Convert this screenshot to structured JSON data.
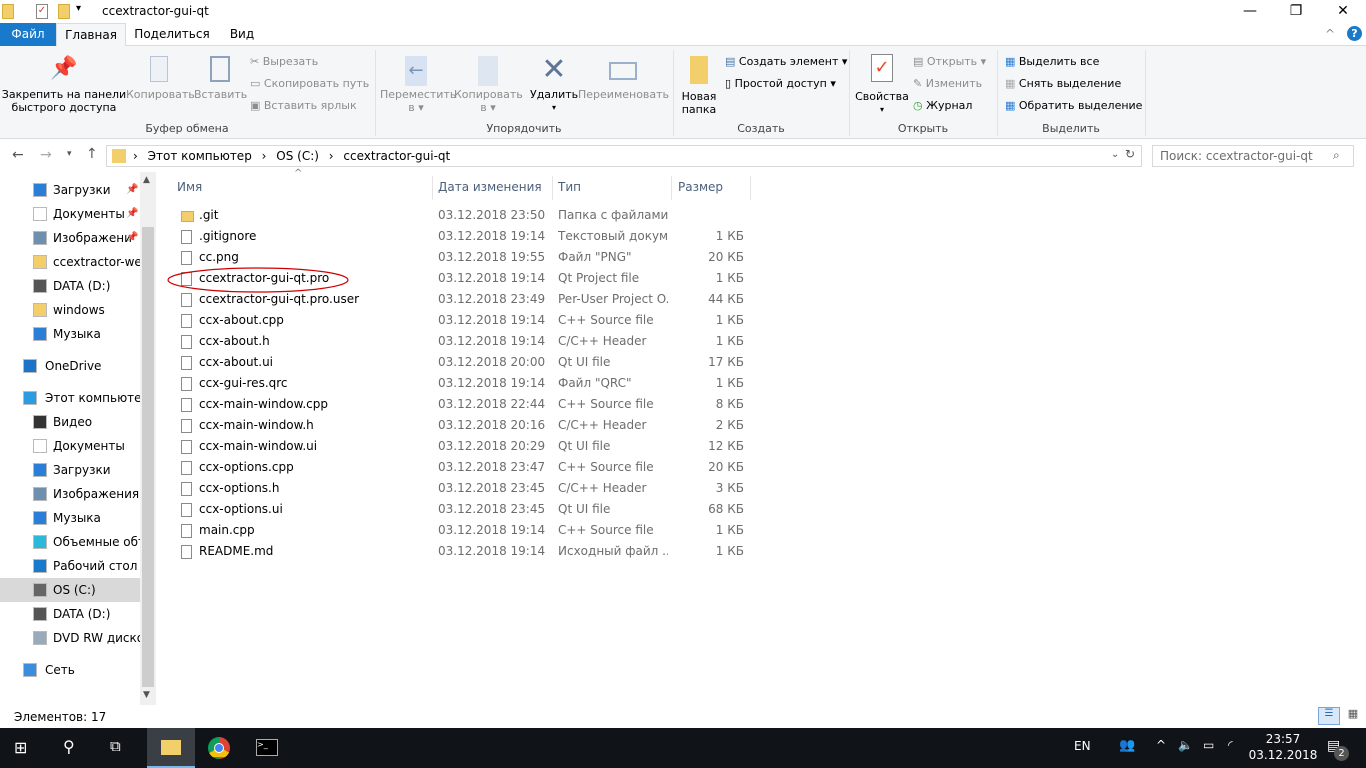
{
  "window": {
    "title": "ccextractor-gui-qt",
    "minimize": "—",
    "maximize": "❐",
    "close": "✕"
  },
  "tabs": [
    {
      "label": "Файл"
    },
    {
      "label": "Главная"
    },
    {
      "label": "Поделиться"
    },
    {
      "label": "Вид"
    }
  ],
  "ribbon": {
    "pin": "Закрепить на панели быстрого доступа",
    "pin1": "Закрепить на панели",
    "pin2": "быстрого доступа",
    "copy": "Копировать",
    "paste": "Вставить",
    "cut": "Вырезать",
    "copy_path": "Скопировать путь",
    "paste_shortcut": "Вставить ярлык",
    "clipboard_group": "Буфер обмена",
    "move1": "Переместить",
    "move2": "в ▾",
    "copyto1": "Копировать",
    "copyto2": "в ▾",
    "delete": "Удалить",
    "delete_arrow": "▾",
    "rename": "Переименовать",
    "organize_group": "Упорядочить",
    "new_folder1": "Новая",
    "new_folder2": "папка",
    "new_item": "Создать элемент ▾",
    "easy_access": "Простой доступ ▾",
    "create_group": "Создать",
    "properties": "Свойства",
    "properties_arrow": "▾",
    "open": "Открыть ▾",
    "edit": "Изменить",
    "history": "Журнал",
    "open_group": "Открыть",
    "select_all": "Выделить все",
    "select_none": "Снять выделение",
    "invert": "Обратить выделение",
    "select_group": "Выделить"
  },
  "address": {
    "path": [
      "Этот компьютер",
      "OS (C:)",
      "ccextractor-gui-qt"
    ],
    "sep": "›",
    "search_placeholder": "Поиск: ccextractor-gui-qt"
  },
  "nav": [
    {
      "label": "Загрузки",
      "icon": "download-icon",
      "pinned": true,
      "level": 2
    },
    {
      "label": "Документы",
      "icon": "documents-icon",
      "pinned": true,
      "level": 2
    },
    {
      "label": "Изображени",
      "icon": "pictures-icon",
      "pinned": true,
      "level": 2
    },
    {
      "label": "ccextractor-web",
      "icon": "folder-icon",
      "level": 2
    },
    {
      "label": "DATA (D:)",
      "icon": "drive-icon",
      "level": 2
    },
    {
      "label": "windows",
      "icon": "folder-icon",
      "level": 2
    },
    {
      "label": "Музыка",
      "icon": "music-icon",
      "level": 2
    },
    {
      "label": "OneDrive",
      "icon": "onedrive-icon",
      "level": 1
    },
    {
      "label": "Этот компьютер",
      "icon": "computer-icon",
      "level": 1
    },
    {
      "label": "Видео",
      "icon": "video-icon",
      "level": 2
    },
    {
      "label": "Документы",
      "icon": "documents-icon",
      "level": 2
    },
    {
      "label": "Загрузки",
      "icon": "download-icon",
      "level": 2
    },
    {
      "label": "Изображения",
      "icon": "pictures-icon",
      "level": 2
    },
    {
      "label": "Музыка",
      "icon": "music-icon",
      "level": 2
    },
    {
      "label": "Объемные объ",
      "icon": "3d-objects-icon",
      "level": 2
    },
    {
      "label": "Рабочий стол",
      "icon": "desktop-icon",
      "level": 2
    },
    {
      "label": "OS (C:)",
      "icon": "os-drive-icon",
      "level": 2,
      "selected": true
    },
    {
      "label": "DATA (D:)",
      "icon": "drive-icon",
      "level": 2
    },
    {
      "label": "DVD RW дисков",
      "icon": "dvd-icon",
      "level": 2
    },
    {
      "label": "Сеть",
      "icon": "network-icon",
      "level": 1
    }
  ],
  "columns": {
    "name": "Имя",
    "date": "Дата изменения",
    "type": "Тип",
    "size": "Размер"
  },
  "files": [
    {
      "name": ".git",
      "date": "03.12.2018 23:50",
      "type": "Папка с файлами",
      "size": "",
      "folder": true
    },
    {
      "name": ".gitignore",
      "date": "03.12.2018 19:14",
      "type": "Текстовый докум...",
      "size": "1 КБ"
    },
    {
      "name": "cc.png",
      "date": "03.12.2018 19:55",
      "type": "Файл \"PNG\"",
      "size": "20 КБ"
    },
    {
      "name": "ccextractor-gui-qt.pro",
      "date": "03.12.2018 19:14",
      "type": "Qt Project file",
      "size": "1 КБ",
      "circled": true
    },
    {
      "name": "ccextractor-gui-qt.pro.user",
      "date": "03.12.2018 23:49",
      "type": "Per-User Project O...",
      "size": "44 КБ"
    },
    {
      "name": "ccx-about.cpp",
      "date": "03.12.2018 19:14",
      "type": "C++ Source file",
      "size": "1 КБ"
    },
    {
      "name": "ccx-about.h",
      "date": "03.12.2018 19:14",
      "type": "C/C++ Header",
      "size": "1 КБ"
    },
    {
      "name": "ccx-about.ui",
      "date": "03.12.2018 20:00",
      "type": "Qt UI file",
      "size": "17 КБ"
    },
    {
      "name": "ccx-gui-res.qrc",
      "date": "03.12.2018 19:14",
      "type": "Файл \"QRC\"",
      "size": "1 КБ"
    },
    {
      "name": "ccx-main-window.cpp",
      "date": "03.12.2018 22:44",
      "type": "C++ Source file",
      "size": "8 КБ"
    },
    {
      "name": "ccx-main-window.h",
      "date": "03.12.2018 20:16",
      "type": "C/C++ Header",
      "size": "2 КБ"
    },
    {
      "name": "ccx-main-window.ui",
      "date": "03.12.2018 20:29",
      "type": "Qt UI file",
      "size": "12 КБ"
    },
    {
      "name": "ccx-options.cpp",
      "date": "03.12.2018 23:47",
      "type": "C++ Source file",
      "size": "20 КБ"
    },
    {
      "name": "ccx-options.h",
      "date": "03.12.2018 23:45",
      "type": "C/C++ Header",
      "size": "3 КБ"
    },
    {
      "name": "ccx-options.ui",
      "date": "03.12.2018 23:45",
      "type": "Qt UI file",
      "size": "68 КБ"
    },
    {
      "name": "main.cpp",
      "date": "03.12.2018 19:14",
      "type": "C++ Source file",
      "size": "1 КБ"
    },
    {
      "name": "README.md",
      "date": "03.12.2018 19:14",
      "type": "Исходный файл ...",
      "size": "1 КБ"
    }
  ],
  "status": {
    "count": "Элементов: 17"
  },
  "taskbar": {
    "lang": "EN",
    "time": "23:57",
    "date": "03.12.2018",
    "notifications": "2"
  },
  "colors": {
    "accent": "#1979ca",
    "annotation": "#d00000",
    "taskbar": "#101419"
  }
}
